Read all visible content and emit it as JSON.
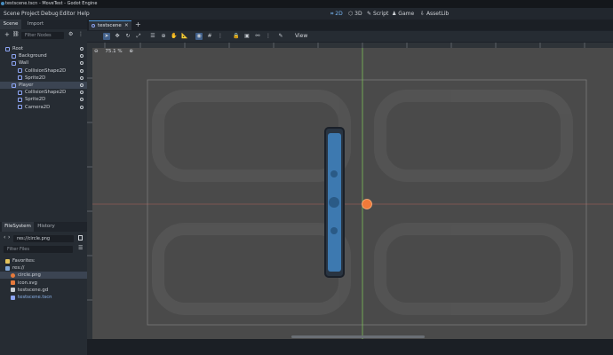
{
  "window": {
    "title": "testscene.tscn - MoveTest - Godot Engine"
  },
  "menu": [
    "Scene",
    "Project",
    "Debug",
    "Editor",
    "Help"
  ],
  "workspaces": [
    {
      "label": "2D",
      "icon": "2d-icon",
      "active": true
    },
    {
      "label": "3D",
      "icon": "3d-icon",
      "active": false
    },
    {
      "label": "Script",
      "icon": "script-icon",
      "active": false
    },
    {
      "label": "Game",
      "icon": "game-icon",
      "active": false
    },
    {
      "label": "AssetLib",
      "icon": "assetlib-icon",
      "active": false
    }
  ],
  "scene_dock": {
    "tabs": [
      "Scene",
      "Import"
    ],
    "filter_placeholder": "Filter Nodes",
    "nodes": [
      {
        "label": "Root",
        "icon": "node2d-icon",
        "color": "#8da5f3",
        "indent": 0,
        "selected": false,
        "eye": true
      },
      {
        "label": "Background",
        "icon": "sprite-icon",
        "color": "#8da5f3",
        "indent": 1,
        "selected": false,
        "eye": true
      },
      {
        "label": "Wall",
        "icon": "static-body-icon",
        "color": "#8da5f3",
        "indent": 1,
        "selected": false,
        "eye": true
      },
      {
        "label": "CollisionShape2D",
        "icon": "collision-icon",
        "color": "#8da5f3",
        "indent": 2,
        "selected": false,
        "eye": true
      },
      {
        "label": "Sprite2D",
        "icon": "sprite-icon",
        "color": "#8da5f3",
        "indent": 2,
        "selected": false,
        "eye": true
      },
      {
        "label": "Player",
        "icon": "character-body-icon",
        "color": "#8da5f3",
        "indent": 1,
        "selected": true,
        "eye": true
      },
      {
        "label": "CollisionShape2D",
        "icon": "collision-icon",
        "color": "#8da5f3",
        "indent": 2,
        "selected": false,
        "eye": true
      },
      {
        "label": "Sprite2D",
        "icon": "sprite-icon",
        "color": "#8da5f3",
        "indent": 2,
        "selected": false,
        "eye": true
      },
      {
        "label": "Camera2D",
        "icon": "camera-icon",
        "color": "#8da5f3",
        "indent": 2,
        "selected": false,
        "eye": true
      }
    ]
  },
  "filesystem": {
    "tabs": [
      "FileSystem",
      "History"
    ],
    "path": "res://circle.png",
    "filter_placeholder": "Filter Files",
    "items": [
      {
        "label": "Favorites:",
        "icon": "star-icon",
        "indent": 0,
        "selected": false
      },
      {
        "label": "res://",
        "icon": "folder-icon",
        "indent": 0,
        "selected": false
      },
      {
        "label": "circle.png",
        "icon": "image-icon",
        "indent": 1,
        "selected": true
      },
      {
        "label": "icon.svg",
        "icon": "image-icon",
        "indent": 1,
        "selected": false
      },
      {
        "label": "testscene.gd",
        "icon": "gear-icon",
        "indent": 1,
        "selected": false
      },
      {
        "label": "testscene.tscn",
        "icon": "scene-icon",
        "indent": 1,
        "selected": false
      }
    ]
  },
  "scene_tab": {
    "label": "testscene"
  },
  "toolbar": {
    "view_label": "View"
  },
  "viewport": {
    "zoom": "75.1 %"
  },
  "colors": {
    "accent": "#4f9be0",
    "selected": "#3b4452",
    "sprite": "#3d79b0",
    "player_marker": "#f07a3a"
  }
}
